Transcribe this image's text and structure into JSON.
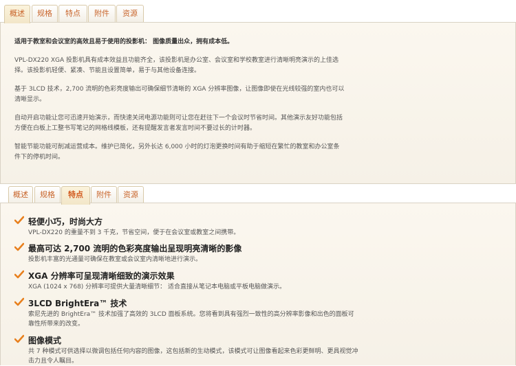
{
  "top": {
    "tabs": [
      "概述",
      "规格",
      "特点",
      "附件",
      "资源"
    ],
    "active_tab": 0,
    "lead": "适用于教室和会议室的高效且易于使用的投影机： 图像质量出众，拥有成本低。",
    "paragraphs": [
      "VPL-DX220 XGA 投影机具有成本效益且功能齐全，该投影机是办公室、会议室和学校教室进行清晰明亮演示的上佳选择。该投影机轻便、紧凑、节能且设置简单，易于与其他设备连接。",
      "基于 3LCD 技术，2,700 流明的色彩亮度输出可确保细节清晰的 XGA 分辨率图像，让图像即使在光线较强的室内也可以清晰显示。",
      "自动开启功能让您可迅速开始演示，而快速关闭电源功能则可让您在赶往下一个会议时节省时间。其他演示友好功能包括方便在白板上工整书写笔记的网格线模板，还有提醒发言者发言时间不要过长的计时器。",
      "智能节能功能可削减运营成本。维护已简化，另外长达 6,000 小时的灯泡更换时间有助于缩短在繁忙的教室和办公室条件下的停机时间。"
    ]
  },
  "bottom": {
    "tabs": [
      "概述",
      "规格",
      "特点",
      "附件",
      "资源"
    ],
    "active_tab": 2,
    "features": [
      {
        "title": "轻便小巧，时尚大方",
        "desc": "VPL-DX220 的重量不到 3 千克，节省空间，便于在会议室或教室之间携带。"
      },
      {
        "title": "最高可达 2,700 流明的色彩亮度输出呈现明亮清晰的影像",
        "desc": "投影机丰富的光通量可确保在教室或会议室内清晰地进行演示。"
      },
      {
        "title": "XGA 分辨率可呈现清晰细致的演示效果",
        "desc": "XGA (1024 x 768) 分辨率可提供大量清晰细节： 适合直接从笔记本电脑或平板电脑做演示。"
      },
      {
        "title": "3LCD BrightEra™ 技术",
        "desc": "索尼先进的 BrightEra™ 技术加强了高效的 3LCD 面板系统。您将看到具有强烈一致性的高分辨率影像和出色的面板可靠性所带来的改变。"
      },
      {
        "title": "图像模式",
        "desc": "共 7 种模式可供选择以微调包括任何内容的图像，这包括新的生动模式，该模式可让图像看起来色彩更鲜明、更具视觉冲击力且令人瞩目。"
      }
    ]
  },
  "colors": {
    "accent": "#e0782a",
    "check": "#e8801e",
    "tab_text": "#c8642a"
  }
}
